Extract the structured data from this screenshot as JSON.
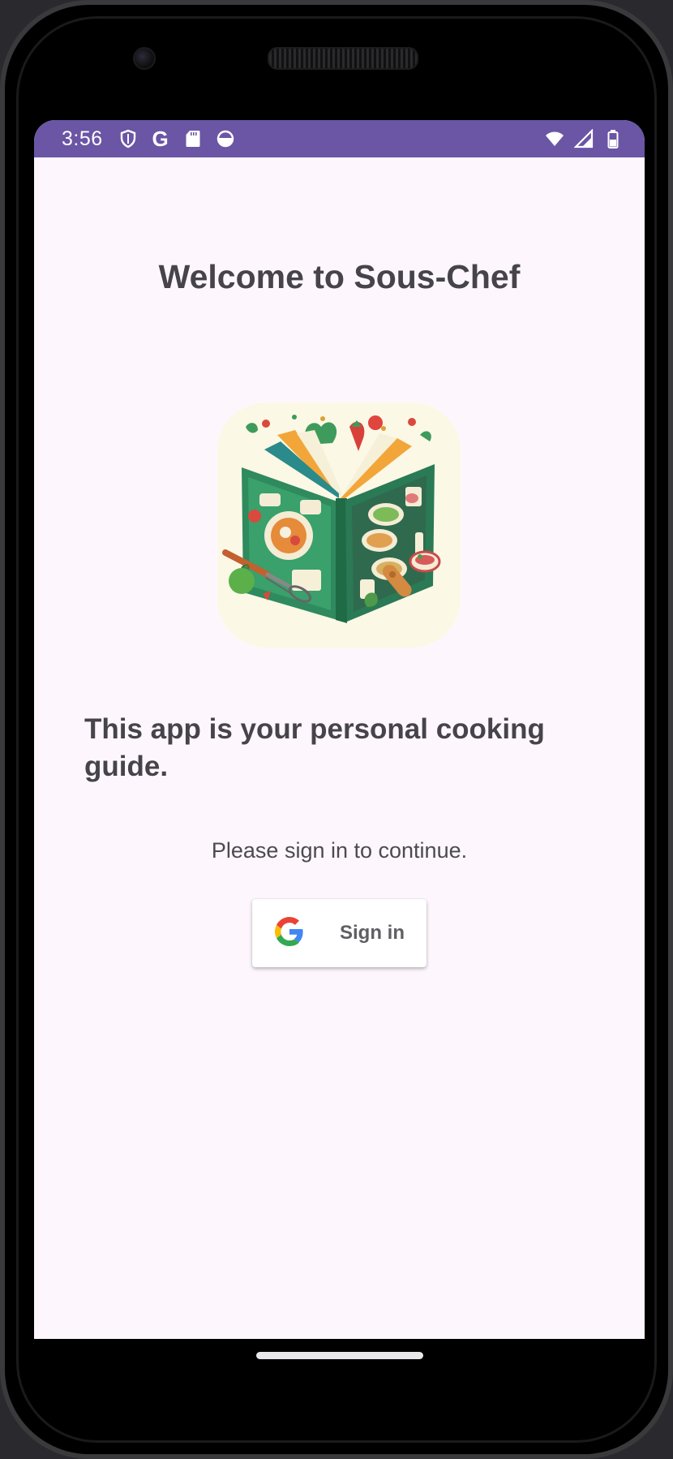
{
  "status_bar": {
    "time": "3:56",
    "google_letter": "G",
    "left_icons": [
      "shield-icon",
      "google-g-icon",
      "sd-card-icon",
      "smile-face-icon"
    ],
    "right_icons": [
      "wifi-icon",
      "signal-icon",
      "battery-icon"
    ],
    "color": "#6b55a5"
  },
  "main": {
    "title": "Welcome to Sous-Chef",
    "tagline": "This app is your personal cooking guide.",
    "prompt": "Please sign in to continue.",
    "signin_label": "Sign in",
    "logo_icon": "cookbook-logo-icon"
  },
  "colors": {
    "background": "#fdf7fd",
    "text": "#46444a",
    "book_green": "#2f8a5e"
  }
}
